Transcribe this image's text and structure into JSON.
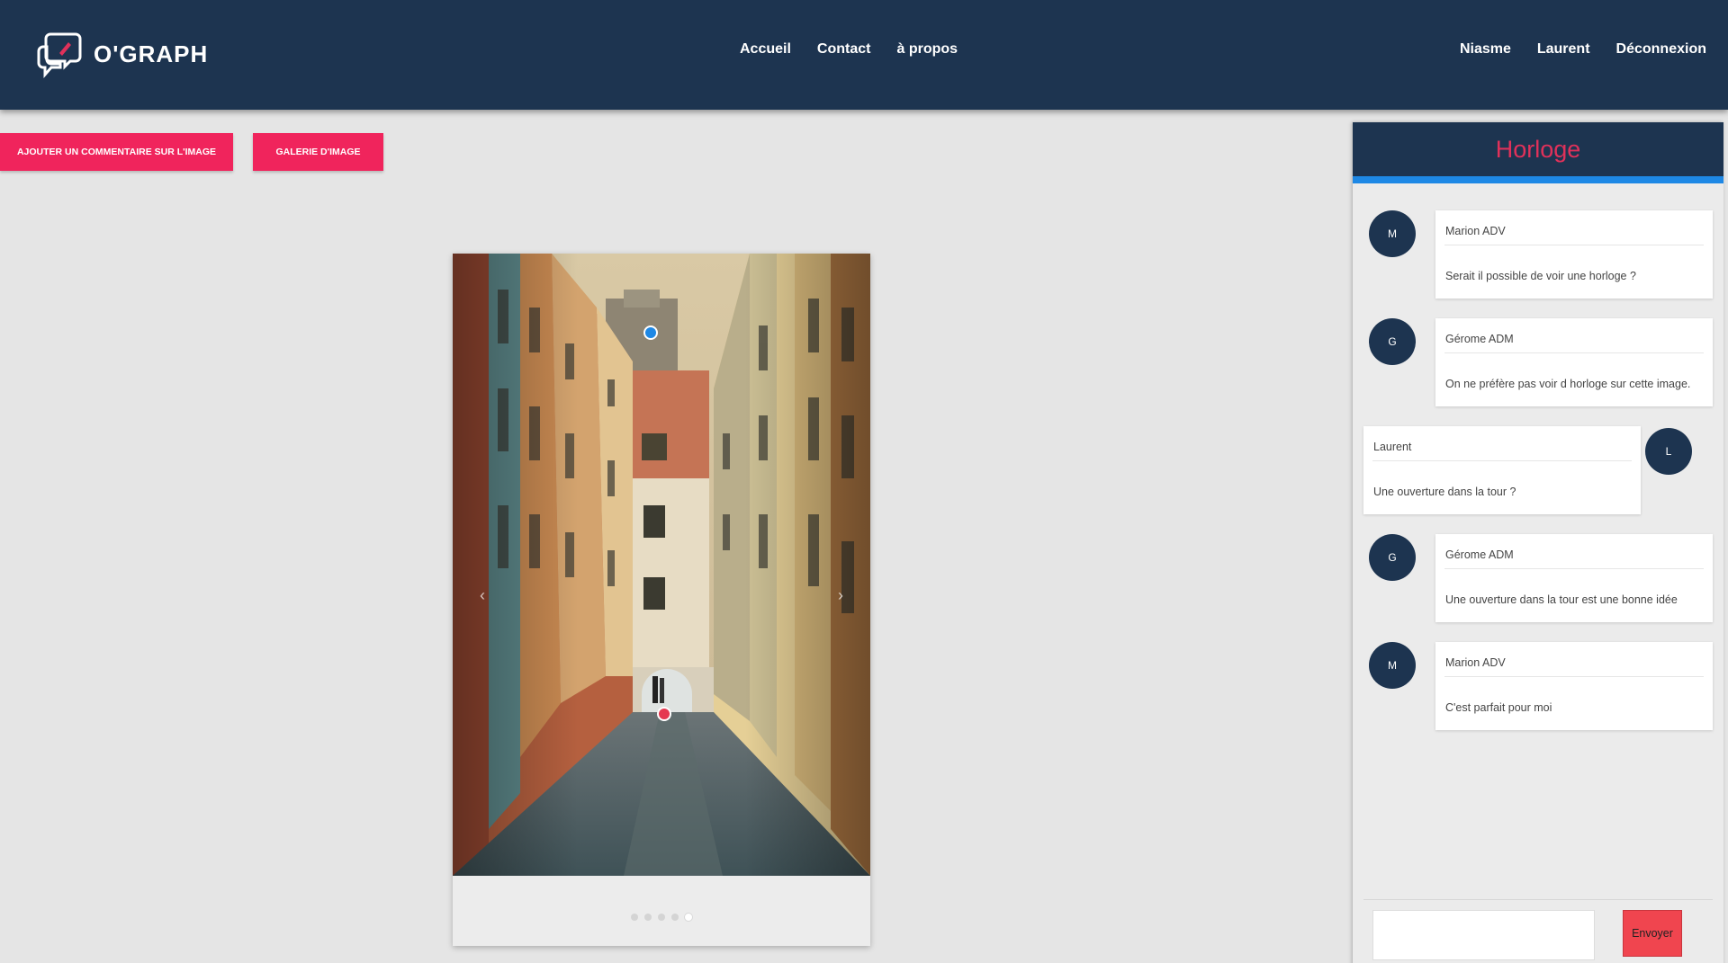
{
  "brand": {
    "name": "O'GRAPH"
  },
  "nav": {
    "center": [
      "Accueil",
      "Contact",
      "à propos"
    ],
    "right": [
      "Niasme",
      "Laurent",
      "Déconnexion"
    ]
  },
  "actions": {
    "add_comment": "AJOUTER UN COMMENTAIRE SUR L'IMAGE",
    "gallery": "GALERIE D'IMAGE"
  },
  "carousel": {
    "prev_icon": "‹",
    "next_icon": "›",
    "slide_count": 5,
    "active_slide": 5
  },
  "chat": {
    "title": "Horloge",
    "messages": [
      {
        "avatar": "M",
        "author": "Marion ADV",
        "text": "Serait il possible de voir une horloge ?",
        "side": "left"
      },
      {
        "avatar": "G",
        "author": "Gérome ADM",
        "text": "On ne préfère pas voir d horloge sur cette image.",
        "side": "left"
      },
      {
        "avatar": "L",
        "author": "Laurent",
        "text": "Une ouverture dans la tour ?",
        "side": "right"
      },
      {
        "avatar": "G",
        "author": "Gérome ADM",
        "text": "Une ouverture dans la tour est une bonne idée",
        "side": "left"
      },
      {
        "avatar": "M",
        "author": "Marion ADV",
        "text": "C'est parfait pour moi",
        "side": "left"
      }
    ],
    "input_placeholder": "",
    "send_label": "Envoyer"
  },
  "colors": {
    "navbar": "#1d3450",
    "accent_pink": "#f0245c",
    "chat_title": "#e0315a",
    "chat_header_border": "#1e88e5",
    "send_button": "#f0454f",
    "pin_blue": "#1e88e5",
    "pin_red": "#e53950"
  }
}
